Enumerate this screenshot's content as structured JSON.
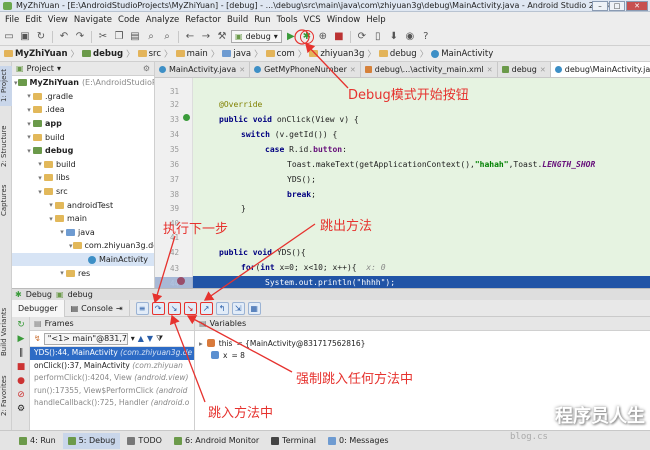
{
  "window": {
    "title": "MyZhiYuan - [E:\\AndroidStudioProjects\\MyZhiYuan] - [debug] - ...\\debug\\src\\main\\java\\com\\zhiyuan3g\\debug\\MainActivity.java - Android Studio 2.1.3",
    "minimize": "–",
    "maximize": "□",
    "close": "✕"
  },
  "menu": [
    "File",
    "Edit",
    "View",
    "Navigate",
    "Code",
    "Analyze",
    "Refactor",
    "Build",
    "Run",
    "Tools",
    "VCS",
    "Window",
    "Help"
  ],
  "toolbar": {
    "config_label": "debug"
  },
  "breadcrumb": [
    "MyZhiYuan",
    "debug",
    "src",
    "main",
    "java",
    "com",
    "zhiyuan3g",
    "debug",
    "MainActivity"
  ],
  "project": {
    "view_label": "Project",
    "tree": [
      {
        "label": "MyZhiYuan",
        "extra": "(E:\\AndroidStudioProje",
        "depth": 0,
        "icon": "module",
        "bold": true
      },
      {
        "label": ".gradle",
        "depth": 1,
        "icon": "folder"
      },
      {
        "label": ".idea",
        "depth": 1,
        "icon": "folder"
      },
      {
        "label": "app",
        "depth": 1,
        "icon": "module",
        "bold": true
      },
      {
        "label": "build",
        "depth": 1,
        "icon": "folder"
      },
      {
        "label": "debug",
        "depth": 1,
        "icon": "module",
        "bold": true
      },
      {
        "label": "build",
        "depth": 2,
        "icon": "folder"
      },
      {
        "label": "libs",
        "depth": 2,
        "icon": "folder"
      },
      {
        "label": "src",
        "depth": 2,
        "icon": "folder"
      },
      {
        "label": "androidTest",
        "depth": 3,
        "icon": "folder"
      },
      {
        "label": "main",
        "depth": 3,
        "icon": "folder"
      },
      {
        "label": "java",
        "depth": 4,
        "icon": "folder-blue"
      },
      {
        "label": "com.zhiyuan3g.deb",
        "depth": 5,
        "icon": "folder"
      },
      {
        "label": "MainActivity",
        "depth": 6,
        "icon": "class",
        "selected": true
      },
      {
        "label": "res",
        "depth": 4,
        "icon": "folder"
      }
    ]
  },
  "left_tool_tabs": [
    "1: Project",
    "2: Structure",
    "Captures",
    "Build Variants",
    "2: Favorites"
  ],
  "editor_tabs": [
    {
      "label": "MainActivity.java",
      "active": false
    },
    {
      "label": "GetMyPhoneNumber",
      "active": false
    },
    {
      "label": "debug\\...\\activity_main.xml",
      "active": false
    },
    {
      "label": "debug",
      "active": false
    },
    {
      "label": "debug\\MainActivity.java",
      "active": true
    }
  ],
  "code": {
    "line_numbers": [
      "31",
      "32",
      "33",
      "34",
      "35",
      "36",
      "37",
      "38",
      "39",
      "40",
      "41",
      "42",
      "43",
      "44"
    ],
    "line_32": "@Override",
    "line_33": [
      "public",
      " ",
      "void",
      " onClick(View v) {"
    ],
    "line_34": [
      "switch",
      " (v.getId()) {"
    ],
    "line_35": [
      "case",
      " R.id.",
      "button",
      ":"
    ],
    "line_36": [
      "Toast.makeText(getApplicationContext(),",
      "\"hahah\"",
      ",Toast.",
      "LENGTH_SHOR"
    ],
    "line_37": "YDS();",
    "line_38": [
      "break",
      ";"
    ],
    "line_39": "}",
    "line_42": [
      "public",
      " ",
      "void",
      " YDS(){"
    ],
    "line_43": [
      "for",
      "(",
      "int",
      " x=0; x<10; x++){",
      "x: 0"
    ],
    "line_44": "System.out.println(\"hhhh\");"
  },
  "debug": {
    "session_label": "Debug",
    "session_name": "debug",
    "tabs": [
      "Debugger",
      "Console"
    ],
    "frames_label": "Frames",
    "variables_label": "Variables",
    "thread": "\"<1> main\"@831,71...",
    "frames": [
      {
        "method": "YDS():44, MainActivity",
        "loc": "(com.zhiyuan3g.de",
        "selected": true
      },
      {
        "method": "onClick():37, MainActivity",
        "loc": "(com.zhiyuan",
        "selected": false
      },
      {
        "method": "performClick():4204, View",
        "loc": "(android.view)",
        "lib": true
      },
      {
        "method": "run():17355, View$PerformClick",
        "loc": "(android",
        "lib": true
      },
      {
        "method": "handleCallback():725, Handler",
        "loc": "(android.o",
        "lib": true
      }
    ],
    "variables": [
      {
        "name": "this",
        "value": "= {MainActivity@831717562816}"
      },
      {
        "name": "x",
        "value": "= 8"
      }
    ]
  },
  "bottom_tools": [
    {
      "label": "4: Run",
      "active": false
    },
    {
      "label": "5: Debug",
      "active": true
    },
    {
      "label": "TODO",
      "active": false
    },
    {
      "label": "6: Android Monitor",
      "active": false
    },
    {
      "label": "Terminal",
      "active": false
    },
    {
      "label": "0: Messages",
      "active": false
    }
  ],
  "annotations": {
    "debug_start": "Debug模式开始按钮",
    "step_over": "执行下一步",
    "step_out": "跳出方法",
    "force_step_into": "强制跳入任何方法中",
    "step_into": "跳入方法中",
    "color": "#e6322e"
  },
  "watermark": {
    "text": "程序员人生",
    "url": "blog.cs"
  }
}
